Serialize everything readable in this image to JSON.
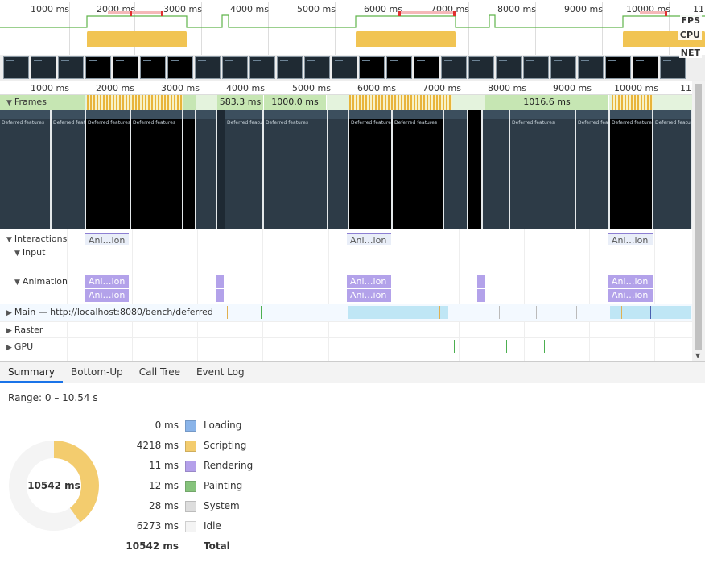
{
  "overview": {
    "ticks": [
      "1000 ms",
      "2000 ms",
      "3000 ms",
      "4000 ms",
      "5000 ms",
      "6000 ms",
      "7000 ms",
      "8000 ms",
      "9000 ms",
      "10000 ms",
      "11"
    ],
    "labels": {
      "fps": "FPS",
      "cpu": "CPU",
      "net": "NET"
    }
  },
  "ruler": {
    "ticks": [
      "1000 ms",
      "2000 ms",
      "3000 ms",
      "4000 ms",
      "5000 ms",
      "6000 ms",
      "7000 ms",
      "8000 ms",
      "9000 ms",
      "10000 ms",
      "11("
    ]
  },
  "tracks": {
    "frames": "Frames",
    "frame_durations": [
      "583.3 ms",
      "1000.0 ms",
      "1016.6 ms"
    ],
    "screenshot_title": "Deferred features",
    "interactions": "Interactions",
    "input": "Input",
    "animation": "Animation",
    "anim_label": "Ani…ion",
    "main": "Main — http://localhost:8080/bench/deferred",
    "raster": "Raster",
    "gpu": "GPU"
  },
  "tabs": [
    "Summary",
    "Bottom-Up",
    "Call Tree",
    "Event Log"
  ],
  "summary": {
    "range": "Range: 0 – 10.54 s",
    "total_label": "10542 ms",
    "rows": [
      {
        "value": "0 ms",
        "name": "Loading",
        "color": "#8ab4e9"
      },
      {
        "value": "4218 ms",
        "name": "Scripting",
        "color": "#f3cc6e"
      },
      {
        "value": "11 ms",
        "name": "Rendering",
        "color": "#b4a0ea"
      },
      {
        "value": "12 ms",
        "name": "Painting",
        "color": "#86c37c"
      },
      {
        "value": "28 ms",
        "name": "System",
        "color": "#dddddd"
      },
      {
        "value": "6273 ms",
        "name": "Idle",
        "color": "#f4f4f4"
      }
    ],
    "total": {
      "value": "10542 ms",
      "name": "Total"
    }
  },
  "donut": {
    "scripting_ms": 4218,
    "total_ms": 10542
  }
}
